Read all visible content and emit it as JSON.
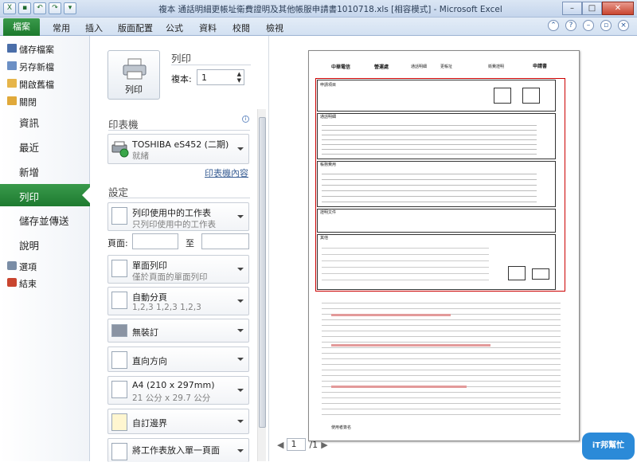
{
  "window": {
    "title": "複本 通話明細更帳址衛費證明及其他帳服申請書1010718.xls [相容模式] - Microsoft Excel"
  },
  "ribbon": {
    "file_tab": "檔案",
    "tabs": [
      "常用",
      "插入",
      "版面配置",
      "公式",
      "資料",
      "校閱",
      "檢視"
    ]
  },
  "backstage": {
    "small": [
      "儲存檔案",
      "另存新檔",
      "開啟舊檔",
      "關閉"
    ],
    "big": [
      "資訊",
      "最近",
      "新增",
      "列印",
      "儲存並傳送",
      "說明"
    ],
    "bottom": [
      "選項",
      "結束"
    ]
  },
  "print": {
    "heading": "列印",
    "copies_label": "複本:",
    "copies_value": "1",
    "print_button": "列印",
    "printer_heading": "印表機",
    "printer_name": "TOSHIBA eS452 (二期)",
    "printer_status": "就緒",
    "printer_props": "印表機內容",
    "settings_heading": "設定",
    "what": {
      "t1": "列印使用中的工作表",
      "t2": "只列印使用中的工作表"
    },
    "pages_label": "頁面:",
    "pages_to": "至",
    "sides": {
      "t1": "單面列印",
      "t2": "僅於頁面的單面列印"
    },
    "collate": {
      "t1": "自動分頁",
      "t2": "1,2,3    1,2,3    1,2,3"
    },
    "staple": "無裝訂",
    "orientation": "直向方向",
    "paper": {
      "t1": "A4 (210 x 297mm)",
      "t2": "21 公分 x 29.7 公分"
    },
    "margins": "自訂邊界",
    "scaling": "將工作表放入單一頁面"
  },
  "preview": {
    "page_value": "1",
    "page_total": "/1",
    "form_title": "申請書",
    "form_headers": [
      "中華電信",
      "營運處",
      "通話明細",
      "更帳址",
      "衛費證明",
      "申請書"
    ],
    "rows": [
      "申請項目",
      "通話明細",
      "帳務費用",
      "證明文件",
      "其他"
    ],
    "footer": "使用者簽名"
  },
  "watermark": "iT邦幫忙"
}
